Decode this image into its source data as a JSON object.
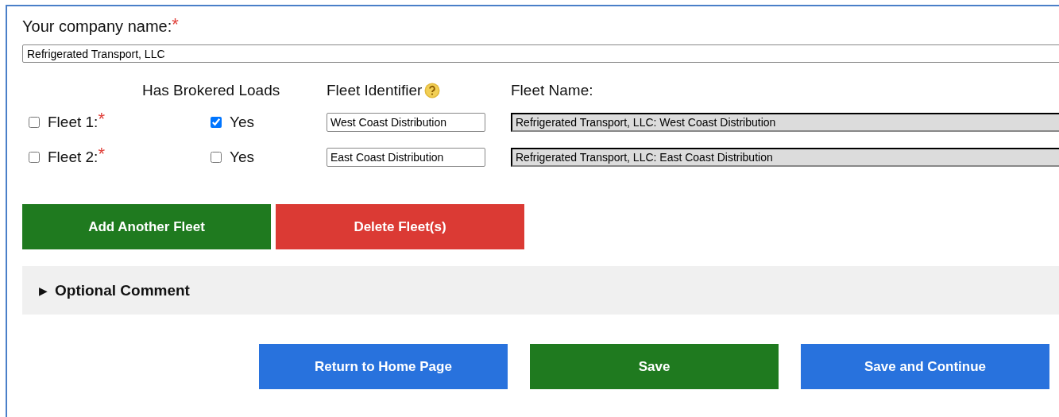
{
  "company": {
    "label": "Your company name:",
    "required_mark": "*",
    "value": "Refrigerated Transport, LLC"
  },
  "fleet_columns": {
    "brokered": "Has Brokered Loads",
    "identifier": "Fleet Identifier",
    "name": "Fleet Name:"
  },
  "fleets": [
    {
      "label": "Fleet 1:",
      "required_mark": "*",
      "checked": false,
      "brokered": {
        "label": "Yes",
        "checked": true
      },
      "identifier": "West Coast Distribution",
      "name": "Refrigerated Transport, LLC: West Coast Distribution"
    },
    {
      "label": "Fleet 2:",
      "required_mark": "*",
      "checked": false,
      "brokered": {
        "label": "Yes",
        "checked": false
      },
      "identifier": "East Coast Distribution",
      "name": "Refrigerated Transport, LLC: East Coast Distribution"
    }
  ],
  "fleet_buttons": [
    {
      "label": "Add Another Fleet",
      "kind": "add"
    },
    {
      "label": "Delete Fleet(s)",
      "kind": "delete"
    }
  ],
  "optional_comment": {
    "marker": "▶",
    "label": "Optional Comment",
    "expanded": false
  },
  "buttons": [
    {
      "label": "Return to Home Page",
      "kind": "nav"
    },
    {
      "label": "Save",
      "kind": "save"
    },
    {
      "label": "Save and Continue",
      "kind": "nav"
    }
  ]
}
